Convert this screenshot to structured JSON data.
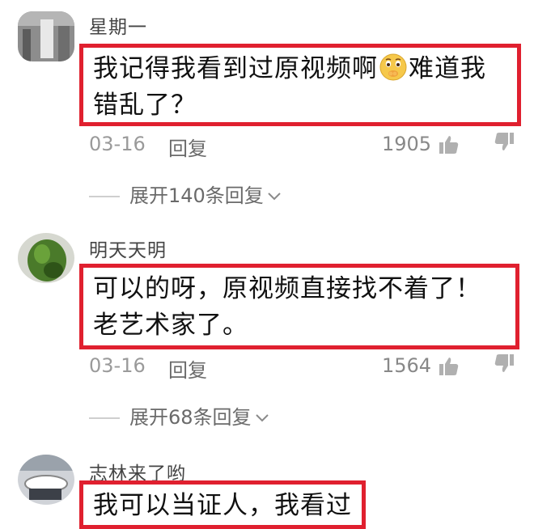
{
  "comments": [
    {
      "username": "星期一",
      "text_before_emoji": "我记得我看到过原视频啊",
      "emoji": "thinking-face-emoji",
      "text_after_emoji": "难道我错乱了？",
      "date": "03-16",
      "reply_label": "回复",
      "likes": "1905",
      "expand_label": "展开140条回复"
    },
    {
      "username": "明天天明",
      "text": "可以的呀，原视频直接找不着了！老艺术家了。",
      "date": "03-16",
      "reply_label": "回复",
      "likes": "1564",
      "expand_label": "展开68条回复"
    },
    {
      "username": "志林来了哟",
      "text": "我可以当证人，我看过"
    }
  ],
  "colors": {
    "highlight_border": "#e0202f",
    "meta_text": "#9a9a9a",
    "body_text": "#111111"
  }
}
